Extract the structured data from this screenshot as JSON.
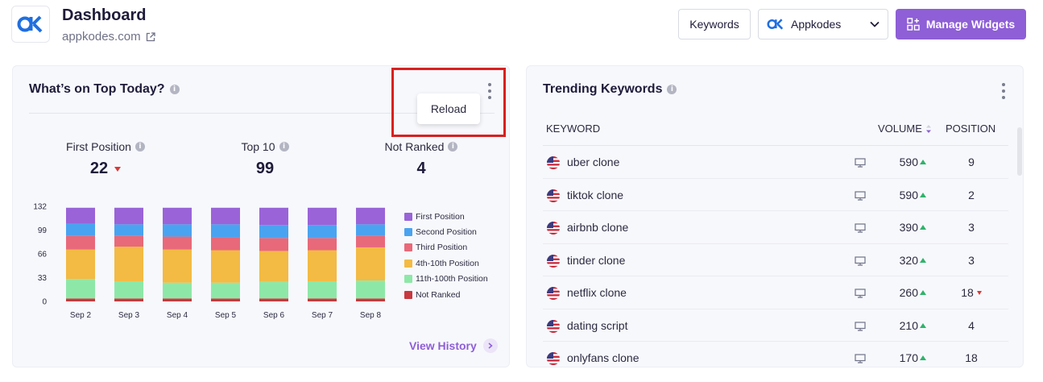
{
  "header": {
    "title": "Dashboard",
    "domain": "appkodes.com",
    "keywords_button": "Keywords",
    "app_select": "Appkodes",
    "manage_button": "Manage Widgets"
  },
  "top_today": {
    "title": "What’s on Top Today?",
    "menu_item": "Reload",
    "stats": [
      {
        "label": "First Position",
        "value": "22",
        "trend": "down"
      },
      {
        "label": "Top 10",
        "value": "99"
      },
      {
        "label": "Not Ranked",
        "value": "4"
      }
    ],
    "view_history": "View History",
    "chart_data": {
      "type": "bar",
      "stacked": true,
      "categories": [
        "Sep 2",
        "Sep 3",
        "Sep 4",
        "Sep 5",
        "Sep 6",
        "Sep 7",
        "Sep 8"
      ],
      "yticks": [
        "0",
        "33",
        "66",
        "99",
        "132"
      ],
      "ylim": [
        0,
        132
      ],
      "legend_position": "right",
      "series": [
        {
          "name": "Not Ranked",
          "color": "#c8383f",
          "values": [
            4,
            4,
            4,
            4,
            4,
            4,
            4
          ]
        },
        {
          "name": "11th-100th Position",
          "color": "#8de8a8",
          "values": [
            27,
            24,
            22,
            22,
            23,
            24,
            25
          ]
        },
        {
          "name": "4th-10th Position",
          "color": "#f3ba44",
          "values": [
            41,
            48,
            46,
            45,
            43,
            43,
            46
          ]
        },
        {
          "name": "Third Position",
          "color": "#e8697a",
          "values": [
            19,
            15,
            18,
            18,
            18,
            17,
            16
          ]
        },
        {
          "name": "Second Position",
          "color": "#4aa3f0",
          "values": [
            17,
            16,
            17,
            18,
            18,
            18,
            16
          ]
        },
        {
          "name": "First Position",
          "color": "#9a63d8",
          "values": [
            22,
            23,
            23,
            23,
            24,
            24,
            23
          ]
        }
      ]
    }
  },
  "trending": {
    "title": "Trending Keywords",
    "columns": {
      "keyword": "KEYWORD",
      "volume": "VOLUME",
      "position": "POSITION"
    },
    "rows": [
      {
        "keyword": "uber clone",
        "volume": "590",
        "position": "9",
        "pos_trend": ""
      },
      {
        "keyword": "tiktok clone",
        "volume": "590",
        "position": "2",
        "pos_trend": ""
      },
      {
        "keyword": "airbnb clone",
        "volume": "390",
        "position": "3",
        "pos_trend": ""
      },
      {
        "keyword": "tinder clone",
        "volume": "320",
        "position": "3",
        "pos_trend": ""
      },
      {
        "keyword": "netflix clone",
        "volume": "260",
        "position": "18",
        "pos_trend": "down"
      },
      {
        "keyword": "dating script",
        "volume": "210",
        "position": "4",
        "pos_trend": ""
      },
      {
        "keyword": "onlyfans clone",
        "volume": "170",
        "position": "18",
        "pos_trend": ""
      }
    ]
  }
}
